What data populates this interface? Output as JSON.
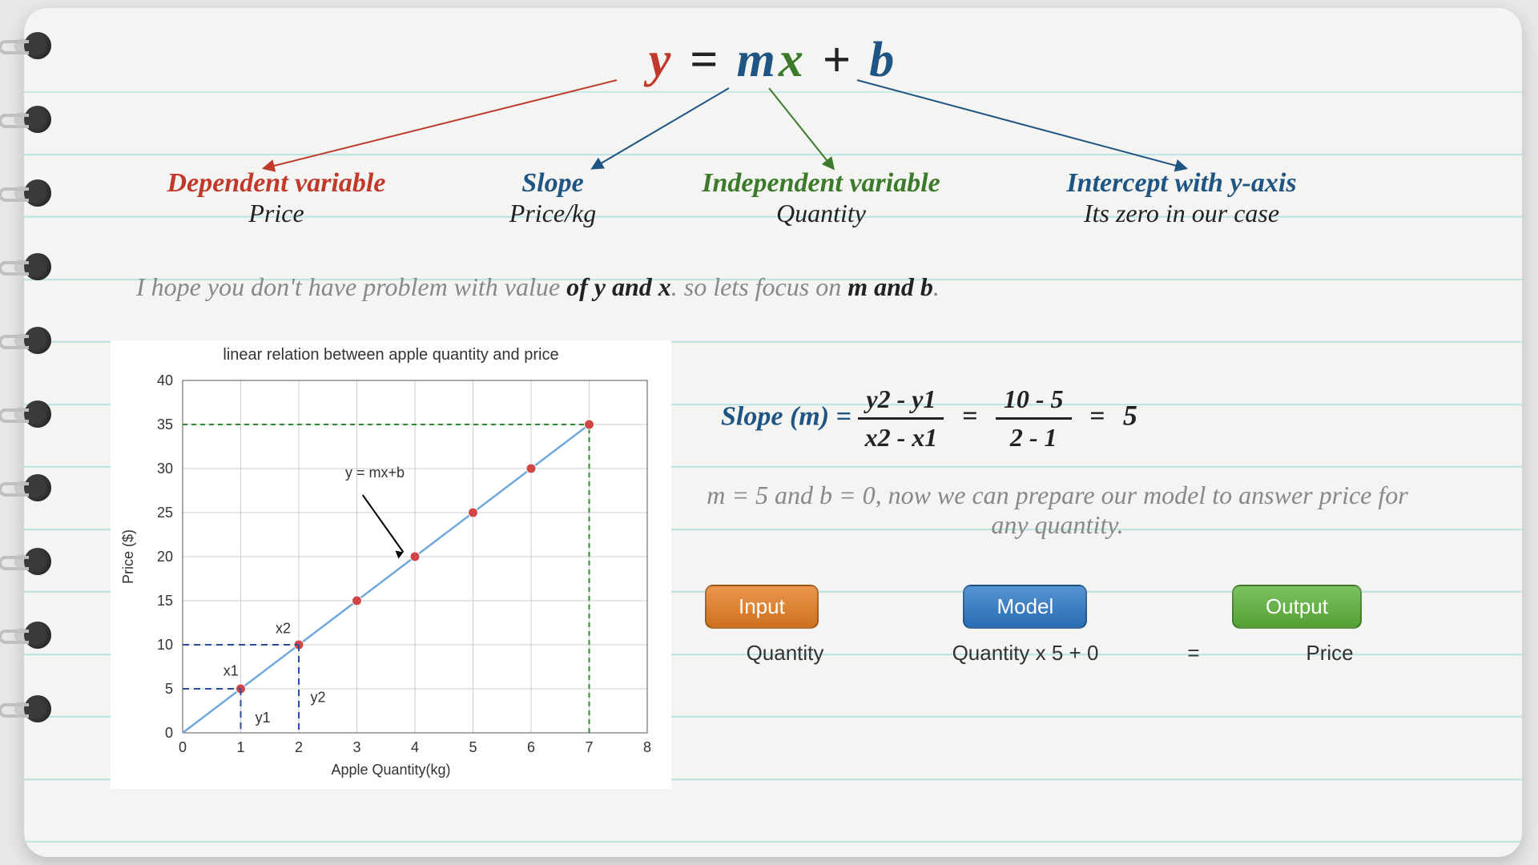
{
  "equation": {
    "y": "y",
    "eq": " = ",
    "m": "m",
    "x": "x",
    "plus": " + ",
    "b": "b"
  },
  "callouts": {
    "y": {
      "title": "Dependent variable",
      "sub": "Price"
    },
    "m": {
      "title": "Slope",
      "sub": "Price/kg"
    },
    "x": {
      "title": "Independent variable",
      "sub": "Quantity"
    },
    "b": {
      "title": "Intercept with y-axis",
      "sub": "Its zero in our case"
    }
  },
  "body": {
    "pre": "I hope you don't have problem with value ",
    "yx": "of y and x",
    "mid": ". so lets focus on ",
    "mb": "m and b",
    "post": "."
  },
  "slope": {
    "label": "Slope (m) = ",
    "num1": "y2 - y1",
    "den1": "x2 - x1",
    "num2": "10 - 5",
    "den2": "2 - 1",
    "answer": "5"
  },
  "model_note": "m = 5 and b = 0, now we can prepare our model to answer price for any quantity.",
  "boxes": {
    "input": "Input",
    "model": "Model",
    "output": "Output",
    "sub_input": "Quantity",
    "sub_model": "Quantity x 5 + 0",
    "sub_eq": "=",
    "sub_output": "Price"
  },
  "chart_data": {
    "type": "scatter",
    "title": "linear relation between apple quantity and price",
    "xlabel": "Apple Quantity(kg)",
    "ylabel": "Price ($)",
    "xlim": [
      0,
      8
    ],
    "ylim": [
      0,
      40
    ],
    "xticks": [
      0,
      1,
      2,
      3,
      4,
      5,
      6,
      7,
      8
    ],
    "yticks": [
      0,
      5,
      10,
      15,
      20,
      25,
      30,
      35,
      40
    ],
    "series": [
      {
        "name": "y = mx+b",
        "x": [
          1,
          2,
          3,
          4,
          5,
          6,
          7
        ],
        "y": [
          5,
          10,
          15,
          20,
          25,
          30,
          35
        ],
        "trendline": true
      }
    ],
    "annotations": {
      "line_label": "y = mx+b",
      "x1": "x1",
      "x2": "x2",
      "y1": "y1",
      "y2": "y2"
    }
  },
  "spiral_count": 10
}
